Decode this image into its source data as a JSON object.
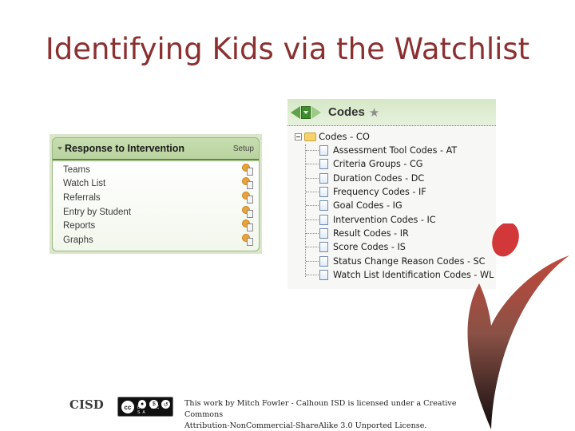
{
  "slide": {
    "title": "Identifying Kids via the Watchlist",
    "title_color": "#8b3030"
  },
  "rti_panel": {
    "title": "Response to Intervention",
    "setup_label": "Setup",
    "items": [
      {
        "label": "Teams",
        "icon": "gear-document-icon"
      },
      {
        "label": "Watch List",
        "icon": "gear-document-icon"
      },
      {
        "label": "Referrals",
        "icon": "gear-document-icon"
      },
      {
        "label": "Entry by Student",
        "icon": "gear-document-icon"
      },
      {
        "label": "Reports",
        "icon": "gear-document-icon"
      },
      {
        "label": "Graphs",
        "icon": "gear-document-icon"
      }
    ]
  },
  "codes_panel": {
    "title": "Codes",
    "icons": [
      "back-arrow-icon",
      "menu-dropdown-icon",
      "forward-arrow-icon",
      "favorite-star-icon"
    ],
    "tree": {
      "root_label": "Codes - CO",
      "items": [
        "Assessment Tool Codes - AT",
        "Criteria Groups - CG",
        "Duration Codes - DC",
        "Frequency Codes - IF",
        "Goal Codes - IG",
        "Intervention Codes - IC",
        "Result Codes - IR",
        "Score Codes - IS",
        "Status Change Reason Codes - SC",
        "Watch List Identification Codes - WL"
      ]
    }
  },
  "footer": {
    "org_logo": "CISD",
    "cc_badge": {
      "main": "cc",
      "tags": "BY NC SA"
    },
    "license_line1": "This work by Mitch Fowler - Calhoun ISD is licensed under a Creative Commons",
    "license_line2": "Attribution-NonCommercial-ShareAlike 3.0 Unported License."
  },
  "colors": {
    "panel_green": "#b9d29e",
    "accent_red": "#d03a34",
    "logo_dark": "#1a1212"
  }
}
